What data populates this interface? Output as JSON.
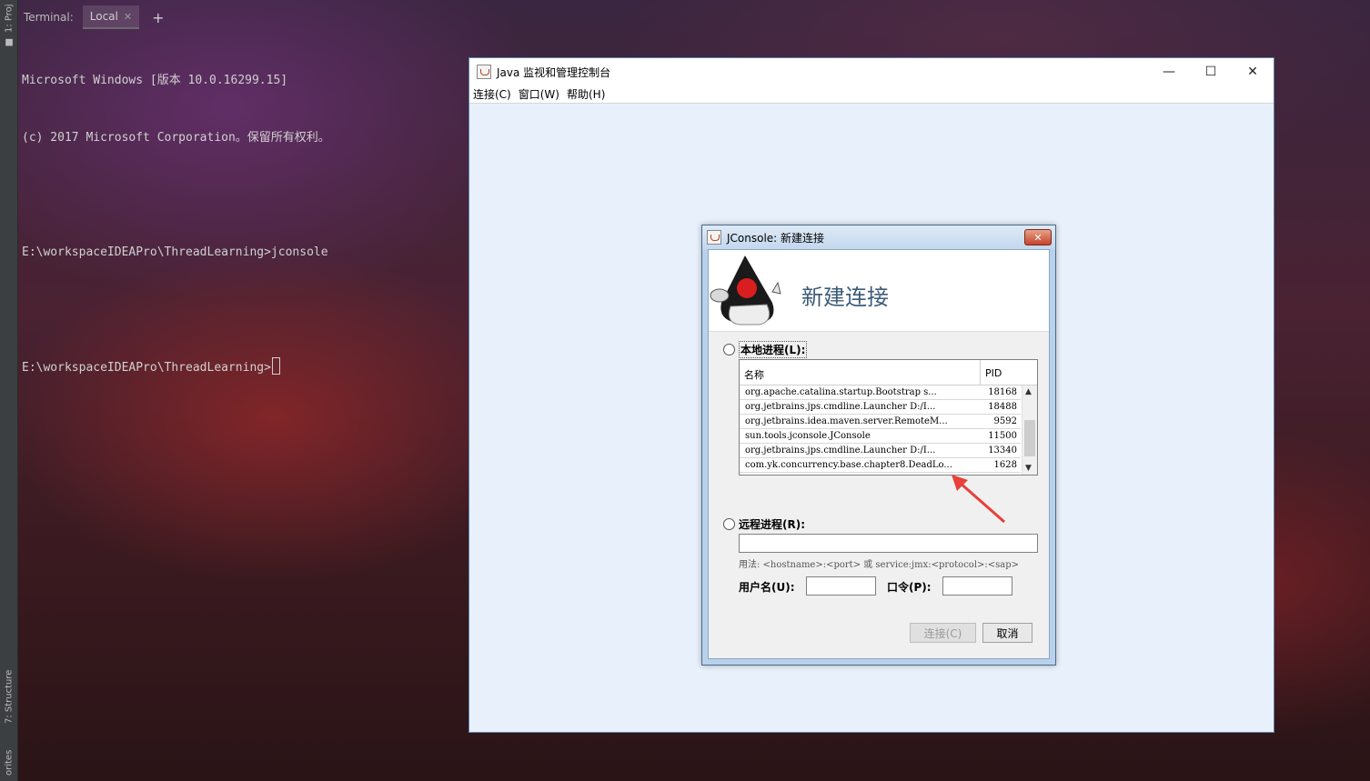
{
  "ide": {
    "strip_tabs": [
      "1: Proj",
      "7: Structure",
      "orites"
    ],
    "terminal_label": "Terminal:",
    "terminal_tab": "Local",
    "lines": [
      "Microsoft Windows [版本 10.0.16299.15]",
      "(c) 2017 Microsoft Corporation。保留所有权利。",
      "",
      "E:\\workspaceIDEAPro\\ThreadLearning>jconsole",
      ""
    ],
    "prompt": "E:\\workspaceIDEAPro\\ThreadLearning>"
  },
  "main_window": {
    "title": "Java 监视和管理控制台",
    "menu": [
      "连接(C)",
      "窗口(W)",
      "帮助(H)"
    ],
    "controls": [
      "—",
      "☐",
      "✕"
    ]
  },
  "dialog": {
    "title": "JConsole: 新建连接",
    "banner_title": "新建连接",
    "local_label": "本地进程(L):",
    "table_headers": {
      "name": "名称",
      "pid": "PID"
    },
    "processes": [
      {
        "name": "org.apache.catalina.startup.Bootstrap s...",
        "pid": "18168"
      },
      {
        "name": "org.jetbrains.jps.cmdline.Launcher D:/I...",
        "pid": "18488"
      },
      {
        "name": "org.jetbrains.idea.maven.server.RemoteM...",
        "pid": "9592"
      },
      {
        "name": "sun.tools.jconsole.JConsole",
        "pid": "11500"
      },
      {
        "name": "org.jetbrains.jps.cmdline.Launcher D:/I...",
        "pid": "13340"
      },
      {
        "name": "com.yk.concurrency.base.chapter8.DeadLo...",
        "pid": "1628"
      }
    ],
    "remote_label": "远程进程(R):",
    "usage": "用法: <hostname>:<port> 或 service:jmx:<protocol>:<sap>",
    "username_label": "用户名(U):",
    "password_label": "口令(P):",
    "connect_button": "连接(C)",
    "cancel_button": "取消"
  },
  "colors": {
    "annotation": "#e8403a",
    "dialog_banner_text": "#3d5b79"
  }
}
